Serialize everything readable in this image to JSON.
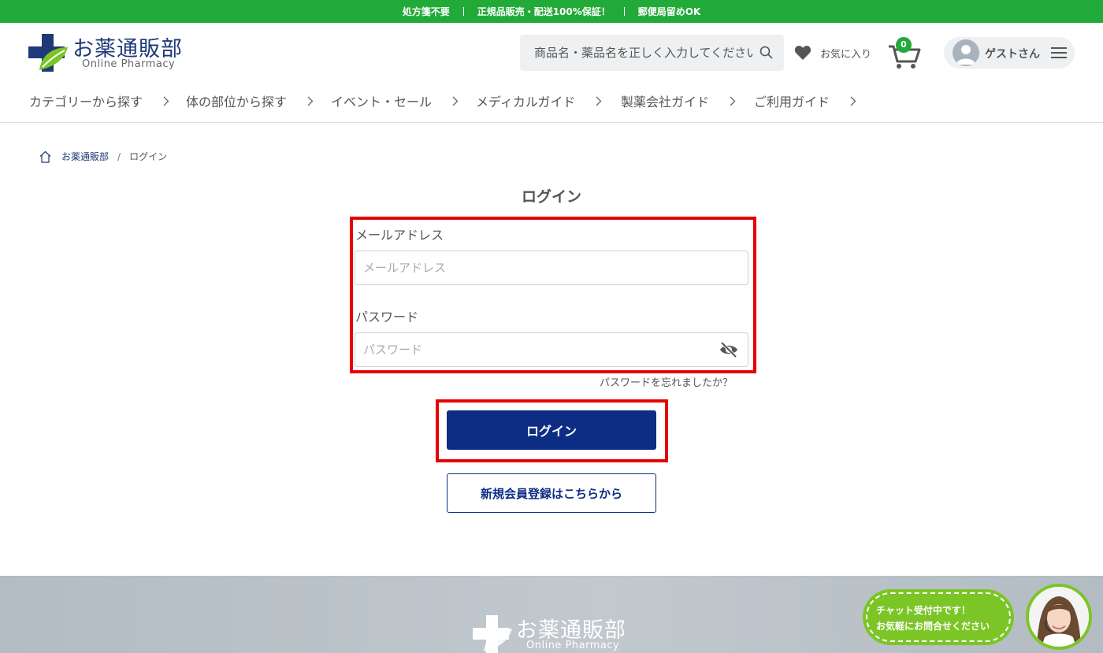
{
  "topbar": {
    "items": [
      "処方箋不要",
      "正規品販売・配送100%保証！",
      "郵便局留めOK"
    ]
  },
  "header": {
    "logo_title": "お薬通販部",
    "logo_subtitle": "Online Pharmacy",
    "search_placeholder": "商品名・薬品名を正しく入力してください",
    "favorites_label": "お気に入り",
    "cart_count": "0",
    "user_name": "ゲストさん"
  },
  "nav": {
    "items": [
      "カテゴリーから探す",
      "体の部位から探す",
      "イベント・セール",
      "メディカルガイド",
      "製薬会社ガイド",
      "ご利用ガイド"
    ]
  },
  "breadcrumb": {
    "home": "お薬通販部",
    "separator": "/",
    "current": "ログイン"
  },
  "login": {
    "title": "ログイン",
    "email_label": "メールアドレス",
    "email_placeholder": "メールアドレス",
    "email_value": "",
    "password_label": "パスワード",
    "password_placeholder": "パスワード",
    "password_value": "",
    "forgot_link": "パスワードを忘れましたか？",
    "submit_label": "ログイン",
    "register_label": "新規会員登録はこちらから"
  },
  "footer": {
    "logo_title": "お薬通販部",
    "logo_subtitle": "Online Pharmacy"
  },
  "chat": {
    "line1": "チャット受付中です！",
    "line2": "お気軽にお問合せください"
  },
  "colors": {
    "brand_green": "#22aa38",
    "brand_navy": "#0c2d83",
    "highlight_red": "#e60000",
    "chat_green": "#7cc527"
  },
  "icons": {
    "search": "search-icon",
    "favorites": "heart-icon",
    "cart": "cart-icon",
    "user": "user-avatar-icon",
    "menu": "hamburger-menu-icon",
    "home": "home-icon",
    "password_toggle": "eye-slash-icon",
    "nav_chevron": "chevron-right-icon"
  }
}
